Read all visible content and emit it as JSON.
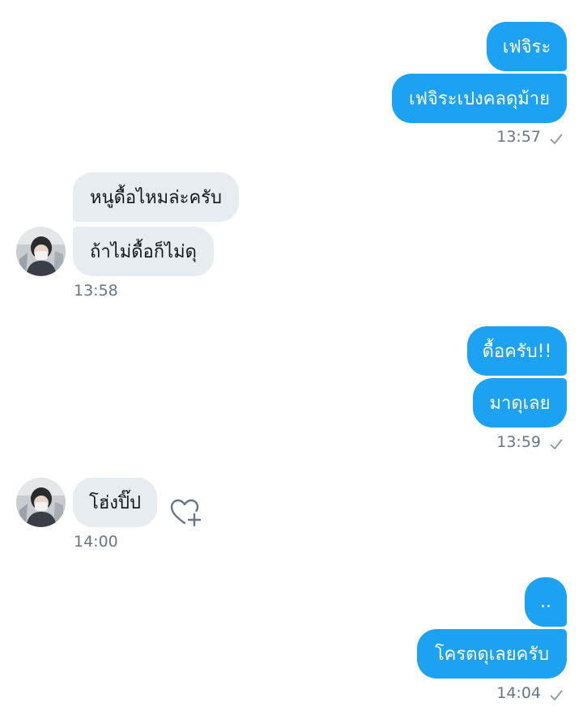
{
  "conversation": {
    "group1": {
      "messages": [
        "เฟจิระ",
        "เฟจิระเปงคลดุม้าย"
      ],
      "time": "13:57"
    },
    "group2": {
      "messages": [
        "หนูดื้อไหมล่ะครับ",
        "ถ้าไม่ดื้อก็ไม่ดุ"
      ],
      "time": "13:58"
    },
    "group3": {
      "messages": [
        "ดื้อครับ!!",
        "มาดุเลย"
      ],
      "time": "13:59"
    },
    "group4": {
      "messages": [
        "โฮ่งปิ๊ป"
      ],
      "time": "14:00"
    },
    "group5": {
      "messages": [
        "..",
        "โครตดุเลยครับ"
      ],
      "time": "14:04"
    }
  },
  "icons": {
    "sent_check": "check-icon",
    "like": "heart-plus-icon",
    "avatar": "avatar"
  },
  "colors": {
    "outgoing_bubble": "#1da1f2",
    "incoming_bubble": "#e6ecf0",
    "timestamp": "#657786"
  }
}
